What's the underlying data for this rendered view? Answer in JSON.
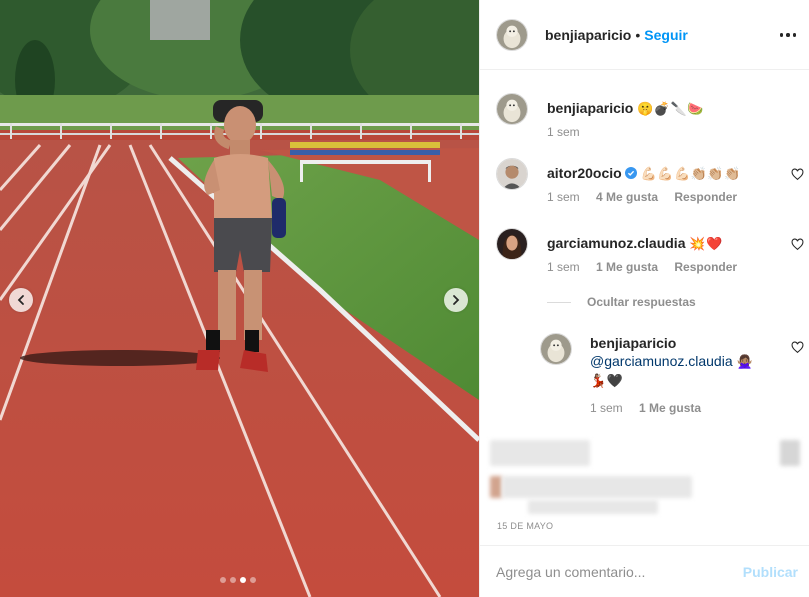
{
  "post": {
    "author": "benjiaparicio",
    "separator": "•",
    "follow_label": "Seguir",
    "date": "15 DE MAYO",
    "carousel": {
      "total": 4,
      "active_index": 2
    }
  },
  "caption": {
    "username": "benjiaparicio",
    "emoji_text": "🤫💣🔪🍉",
    "time": "1 sem"
  },
  "comments": [
    {
      "username": "aitor20ocio",
      "verified": true,
      "emoji_text": "💪🏻💪🏻💪🏻👏🏼👏🏼👏🏼",
      "time": "1 sem",
      "likes": "4 Me gusta",
      "reply_label": "Responder"
    },
    {
      "username": "garciamunoz.claudia",
      "verified": false,
      "emoji_text": "💥❤️",
      "time": "1 sem",
      "likes": "1 Me gusta",
      "reply_label": "Responder",
      "hide_replies_label": "Ocultar respuestas",
      "replies": [
        {
          "username": "benjiaparicio",
          "mention": "@garciamunoz.claudia",
          "emoji_a": "🙅🏽‍♀️",
          "emoji_b": "💃🏽🖤",
          "time": "1 sem",
          "likes": "1 Me gusta"
        }
      ]
    }
  ],
  "composer": {
    "placeholder": "Agrega un comentario...",
    "publish_label": "Publicar"
  },
  "colors": {
    "accent": "#0095f6",
    "publish_disabled": "#b2dffc",
    "meta_text": "#8e8e8e",
    "mention": "#00376b",
    "verified": "#3897f0",
    "track": "#c24a3c"
  },
  "icons": [
    "chevron-left-icon",
    "chevron-right-icon",
    "more-icon",
    "heart-icon",
    "verified-icon"
  ]
}
